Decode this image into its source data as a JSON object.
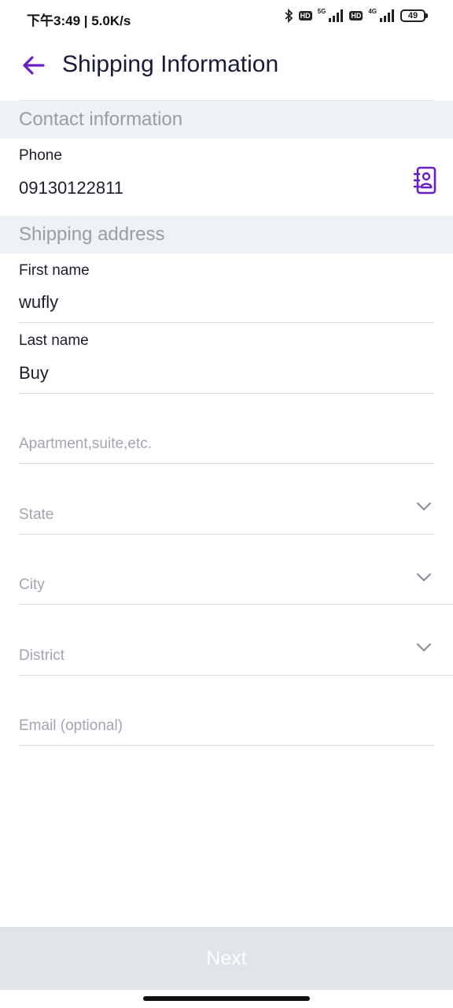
{
  "status_bar": {
    "time": "下午3:49 | 5.0K/s",
    "bluetooth_icon": "bluetooth-icon",
    "hd1": "HD",
    "net1": "5G",
    "hd2": "HD",
    "net2": "4G",
    "battery": "49"
  },
  "header": {
    "title": "Shipping Information",
    "back_icon": "arrow-left-icon"
  },
  "contact_section": {
    "title": "Contact information",
    "phone_label": "Phone",
    "phone_value": "09130122811",
    "contacts_icon": "address-book-icon"
  },
  "shipping_section": {
    "title": "Shipping address",
    "first_name_label": "First name",
    "first_name_value": "wufly",
    "last_name_label": "Last name",
    "last_name_value": "Buy",
    "apartment_placeholder": "Apartment,suite,etc.",
    "state_placeholder": "State",
    "city_placeholder": "City",
    "district_placeholder": "District",
    "email_placeholder": "Email (optional)"
  },
  "footer": {
    "next_label": "Next"
  },
  "colors": {
    "accent": "#6a1fc4",
    "section_bg": "#eef1f8",
    "button_disabled": "#dfe4ec"
  }
}
